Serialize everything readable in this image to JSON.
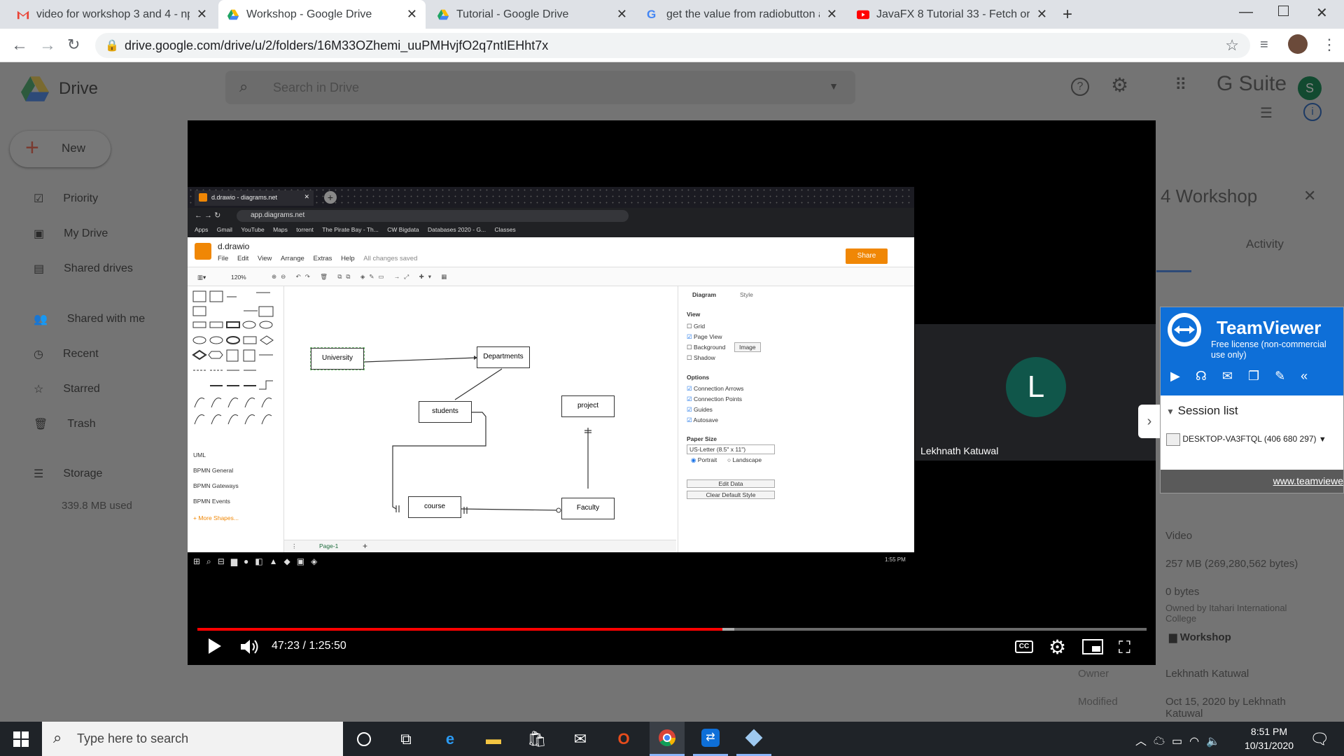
{
  "browser": {
    "tabs": [
      {
        "title": "video for workshop 3 and 4 - np",
        "icon": "gmail-icon",
        "active": false
      },
      {
        "title": "Workshop - Google Drive",
        "icon": "drive-icon",
        "active": true
      },
      {
        "title": "Tutorial - Google Drive",
        "icon": "drive-icon",
        "active": false
      },
      {
        "title": "get the value from radiobutton a",
        "icon": "google-icon",
        "active": false
      },
      {
        "title": "JavaFX 8 Tutorial 33 - Fetch or G",
        "icon": "youtube-icon",
        "active": false
      }
    ],
    "url": "drive.google.com/drive/u/2/folders/16M33OZhemi_uuPMHvjfO2q7ntIEHht7x"
  },
  "drive": {
    "logo_text": "Drive",
    "search_placeholder": "Search in Drive",
    "gsuite": "G Suite",
    "avatar_letter": "S",
    "new_label": "New",
    "sidebar": [
      "Priority",
      "My Drive",
      "Shared drives",
      "Shared with me",
      "Recent",
      "Starred",
      "Trash",
      "Storage"
    ],
    "storage_used": "339.8 MB used",
    "panel_title": "4 Workshop",
    "activity_tab": "Activity",
    "details": {
      "type": "Video",
      "size": "257 MB (269,280,562 bytes)",
      "storage": "0 bytes",
      "storage_owner": "Owned by Itahari International College",
      "location": "Workshop",
      "owner_label": "Owner",
      "owner": "Lekhnath Katuwal",
      "modified_label": "Modified",
      "modified": "Oct 15, 2020 by Lekhnath Katuwal"
    }
  },
  "video": {
    "time": "47:23 / 1:25:50",
    "progress": 0.553,
    "buffered": 0.566,
    "participant_letter": "L",
    "participant_name": "Lekhnath Katuwal",
    "inner": {
      "tab_title": "d.drawio - diagrams.net",
      "url": "app.diagrams.net",
      "bookmarks": [
        "Apps",
        "Gmail",
        "YouTube",
        "Maps",
        "torrent",
        "The Pirate Bay - Th...",
        "CW Bigdata",
        "Databases 2020 - G...",
        "Classes"
      ],
      "doc_title": "d.drawio",
      "menu": [
        "File",
        "Edit",
        "View",
        "Arrange",
        "Extras",
        "Help"
      ],
      "saved": "All changes saved",
      "share": "Share",
      "zoom": "120%",
      "nodes": [
        "University",
        "Departments",
        "students",
        "project",
        "course",
        "Faculty"
      ],
      "panel_tabs": [
        "Diagram",
        "Style"
      ],
      "view_label": "View",
      "view_opts": [
        {
          "label": "Grid",
          "checked": false
        },
        {
          "label": "Page View",
          "checked": true
        },
        {
          "label": "Background",
          "checked": false
        },
        {
          "label": "Shadow",
          "checked": false
        }
      ],
      "image_btn": "Image",
      "options_label": "Options",
      "options": [
        {
          "label": "Connection Arrows",
          "checked": true
        },
        {
          "label": "Connection Points",
          "checked": true
        },
        {
          "label": "Guides",
          "checked": true
        },
        {
          "label": "Autosave",
          "checked": true
        }
      ],
      "paper_label": "Paper Size",
      "paper_value": "US-Letter (8.5\" x 11\")",
      "portrait": "Portrait",
      "landscape": "Landscape",
      "edit_data": "Edit Data",
      "clear_style": "Clear Default Style",
      "libs": [
        "UML",
        "BPMN General",
        "BPMN Gateways",
        "BPMN Events"
      ],
      "more_shapes": "+ More Shapes...",
      "page": "Page-1",
      "clock": "1:55 PM"
    }
  },
  "teamviewer": {
    "title": "TeamViewer",
    "license": "Free license (non-commercial use only)",
    "session_list": "Session list",
    "device": "DESKTOP-VA3FTQL (406 680 297)",
    "link": "www.teamviewe"
  },
  "taskbar": {
    "search_placeholder": "Type here to search",
    "time": "8:51 PM",
    "date": "10/31/2020"
  }
}
